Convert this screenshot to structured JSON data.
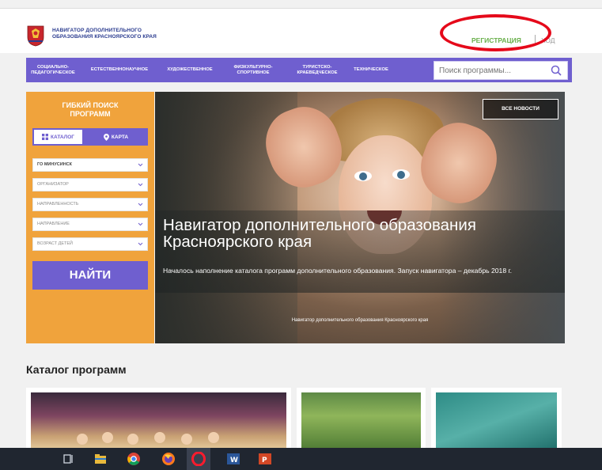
{
  "header": {
    "logo_line1": "НАВИГАТОР ДОПОЛНИТЕЛЬНОГО",
    "logo_line2": "ОБРАЗОВАНИЯ КРАСНОЯРСКОГО КРАЯ",
    "register_label": "РЕГИСТРАЦИЯ",
    "login_label": "ХОД"
  },
  "nav": {
    "items": [
      {
        "line1": "СОЦИАЛЬНО-",
        "line2": "ПЕДАГОГИЧЕСКОЕ"
      },
      {
        "line1": "ЕСТЕСТВЕННОНАУЧНОЕ",
        "line2": ""
      },
      {
        "line1": "ХУДОЖЕСТВЕННОЕ",
        "line2": ""
      },
      {
        "line1": "ФИЗКУЛЬТУРНО-",
        "line2": "СПОРТИВНОЕ"
      },
      {
        "line1": "ТУРИСТСКО-",
        "line2": "КРАЕВЕДЧЕСКОЕ"
      },
      {
        "line1": "ТЕХНИЧЕСКОЕ",
        "line2": ""
      }
    ],
    "search_placeholder": "Поиск программы..."
  },
  "filter": {
    "title_line1": "ГИБКИЙ ПОИСК",
    "title_line2": "ПРОГРАММ",
    "tab_catalog": "КАТАЛОГ",
    "tab_map": "КАРТА",
    "selects": [
      "ГО МИНУСИНСК",
      "ОРГАНИЗАТОР",
      "НАПРАВЛЕННОСТЬ",
      "НАПРАВЛЕНИЕ",
      "ВОЗРАСТ ДЕТЕЙ"
    ],
    "find_label": "НАЙТИ"
  },
  "hero": {
    "all_news": "ВСЕ НОВОСТИ",
    "title": "Навигатор дополнительного образования Красноярского края",
    "subtitle": "Началось наполнение каталога программ дополнительного образования. Запуск навигатора – декабрь 2018 г.",
    "caption": "Навигатор дополнительного образования Красноярского края"
  },
  "catalog": {
    "title": "Каталог программ"
  },
  "colors": {
    "accent_purple": "#6f5fcf",
    "accent_orange": "#f0a33c",
    "register_green": "#6ab04c",
    "annotation_red": "#e5091a"
  }
}
